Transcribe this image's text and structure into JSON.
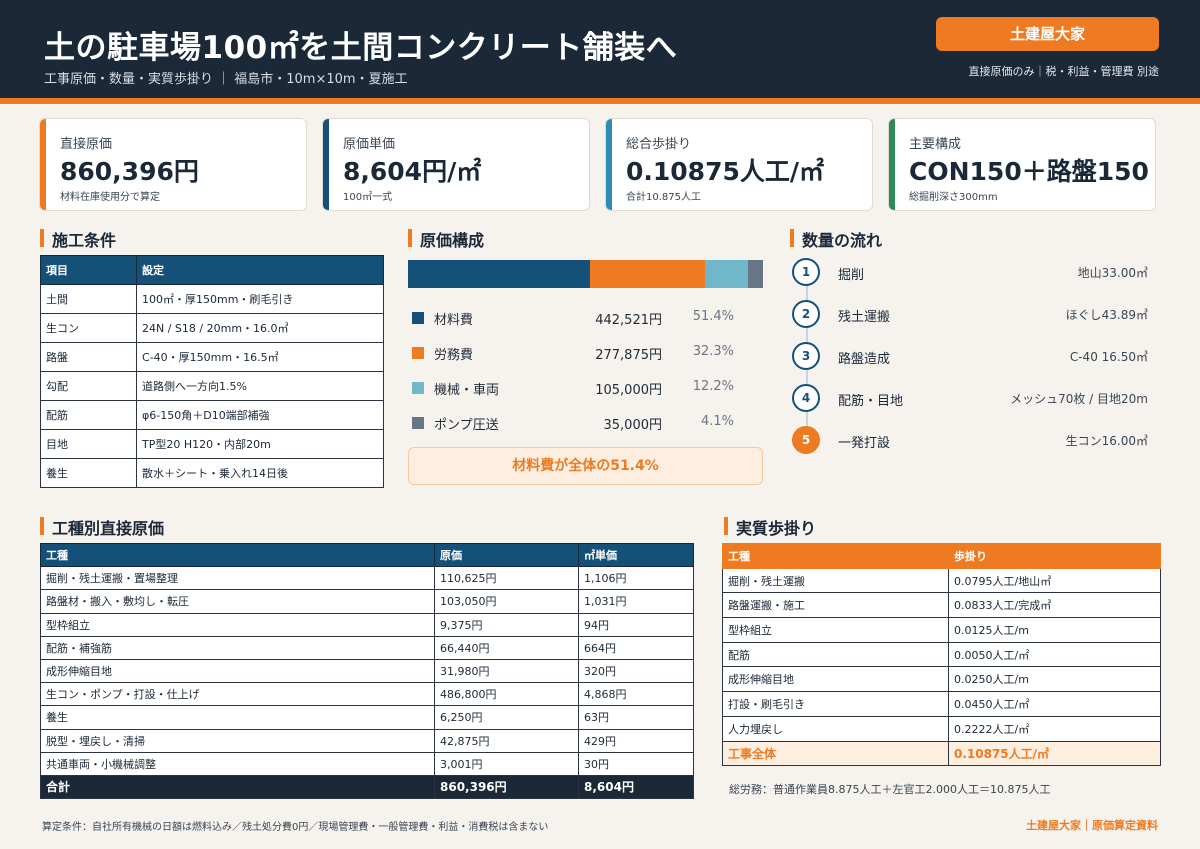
{
  "header": {
    "title": "土の駐車場100㎡を土間コンクリート舗装へ",
    "subtitle": "工事原価・数量・実質歩掛り ｜ 福島市・10m×10m・夏施工",
    "brand": "土建屋大家",
    "note": "直接原価のみ｜税・利益・管理費 別途"
  },
  "kpis": [
    {
      "label": "直接原価",
      "value": "860,396円",
      "note": "材料在庫使用分で算定",
      "color": "#ee7b22"
    },
    {
      "label": "原価単価",
      "value": "8,604円/㎡",
      "note": "100㎡一式",
      "color": "#155079"
    },
    {
      "label": "総合歩掛り",
      "value": "0.10875人工/㎡",
      "note": "合計10.875人工",
      "color": "#2b8fb5"
    },
    {
      "label": "主要構成",
      "value": "CON150＋路盤150",
      "note": "総掘削深さ300mm",
      "color": "#2e8b57"
    }
  ],
  "conditions": {
    "title": "施工条件",
    "headers": [
      "項目",
      "設定"
    ],
    "rows": [
      [
        "土間",
        "100㎡・厚150mm・刷毛引き"
      ],
      [
        "生コン",
        "24N / S18 / 20mm・16.0㎥"
      ],
      [
        "路盤",
        "C-40・厚150mm・16.5㎥"
      ],
      [
        "勾配",
        "道路側へ一方向1.5%"
      ],
      [
        "配筋",
        "φ6-150角＋D10端部補強"
      ],
      [
        "目地",
        "TP型20 H120・内部20m"
      ],
      [
        "養生",
        "散水＋シート・乗入れ14日後"
      ]
    ]
  },
  "cost_breakdown": {
    "title": "原価構成",
    "items": [
      {
        "name": "材料費",
        "amount": "442,521円",
        "pct": "51.4%",
        "share": 51.4,
        "color": "#155079"
      },
      {
        "name": "労務費",
        "amount": "277,875円",
        "pct": "32.3%",
        "share": 32.3,
        "color": "#ee7b22"
      },
      {
        "name": "機械・車両",
        "amount": "105,000円",
        "pct": "12.2%",
        "share": 12.2,
        "color": "#6fb7c9"
      },
      {
        "name": "ポンプ圧送",
        "amount": "35,000円",
        "pct": "4.1%",
        "share": 4.1,
        "color": "#687585"
      }
    ],
    "callout": "材料費が全体の51.4%"
  },
  "flow": {
    "title": "数量の流れ",
    "steps": [
      {
        "num": "1",
        "name": "掘削",
        "value": "地山33.00㎥"
      },
      {
        "num": "2",
        "name": "残土運搬",
        "value": "ほぐし43.89㎥"
      },
      {
        "num": "3",
        "name": "路盤造成",
        "value": "C-40 16.50㎥"
      },
      {
        "num": "4",
        "name": "配筋・目地",
        "value": "メッシュ70枚 / 目地20m"
      },
      {
        "num": "5",
        "name": "一発打設",
        "value": "生コン16.00㎥"
      }
    ]
  },
  "work_costs": {
    "title": "工種別直接原価",
    "headers": [
      "工種",
      "原価",
      "㎡単価"
    ],
    "rows": [
      [
        "掘削・残土運搬・置場整理",
        "110,625円",
        "1,106円"
      ],
      [
        "路盤材・搬入・敷均し・転圧",
        "103,050円",
        "1,031円"
      ],
      [
        "型枠組立",
        "9,375円",
        "94円"
      ],
      [
        "配筋・補強筋",
        "66,440円",
        "664円"
      ],
      [
        "成形伸縮目地",
        "31,980円",
        "320円"
      ],
      [
        "生コン・ポンプ・打設・仕上げ",
        "486,800円",
        "4,868円"
      ],
      [
        "養生",
        "6,250円",
        "63円"
      ],
      [
        "脱型・埋戻し・清掃",
        "42,875円",
        "429円"
      ],
      [
        "共通車両・小機械調整",
        "3,001円",
        "30円"
      ]
    ],
    "total": [
      "合計",
      "860,396円",
      "8,604円"
    ]
  },
  "labor_yield": {
    "title": "実質歩掛り",
    "headers": [
      "工種",
      "歩掛り"
    ],
    "rows": [
      [
        "掘削・残土運搬",
        "0.0795人工/地山㎥"
      ],
      [
        "路盤運搬・施工",
        "0.0833人工/完成㎥"
      ],
      [
        "型枠組立",
        "0.0125人工/m"
      ],
      [
        "配筋",
        "0.0050人工/㎡"
      ],
      [
        "成形伸縮目地",
        "0.0250人工/m"
      ],
      [
        "打設・刷毛引き",
        "0.0450人工/㎡"
      ],
      [
        "人力埋戻し",
        "0.2222人工/㎡"
      ]
    ],
    "total": [
      "工事全体",
      "0.10875人工/㎡"
    ],
    "note": "総労務：普通作業員8.875人工＋左官工2.000人工＝10.875人工"
  },
  "footer": {
    "note": "算定条件：自社所有機械の日額は燃料込み／残土処分費0円／現場管理費・一般管理費・利益・消費税は含まない",
    "brand": "土建屋大家｜原価算定資料"
  }
}
